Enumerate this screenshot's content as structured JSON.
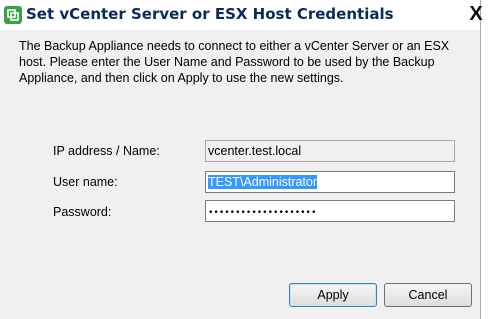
{
  "window": {
    "title": "Set vCenter Server or ESX Host Credentials",
    "close_label": "X"
  },
  "description": "The Backup Appliance needs to connect to either a vCenter Server or an ESX host. Please enter the User Name and Password to be used by the Backup Appliance, and then click on Apply to use the new settings.",
  "form": {
    "ip_label": "IP address / Name:",
    "ip_value": "vcenter.test.local",
    "user_label": "User name:",
    "user_value": "TEST\\Administrator",
    "password_label": "Password:",
    "password_value": "••••••••••••••••••••"
  },
  "buttons": {
    "apply": "Apply",
    "cancel": "Cancel"
  },
  "colors": {
    "title_text": "#0b2a5a",
    "selection": "#3399ff",
    "dialog_bg": "#f0f0f0"
  },
  "icons": {
    "title": "app-logo-icon"
  }
}
